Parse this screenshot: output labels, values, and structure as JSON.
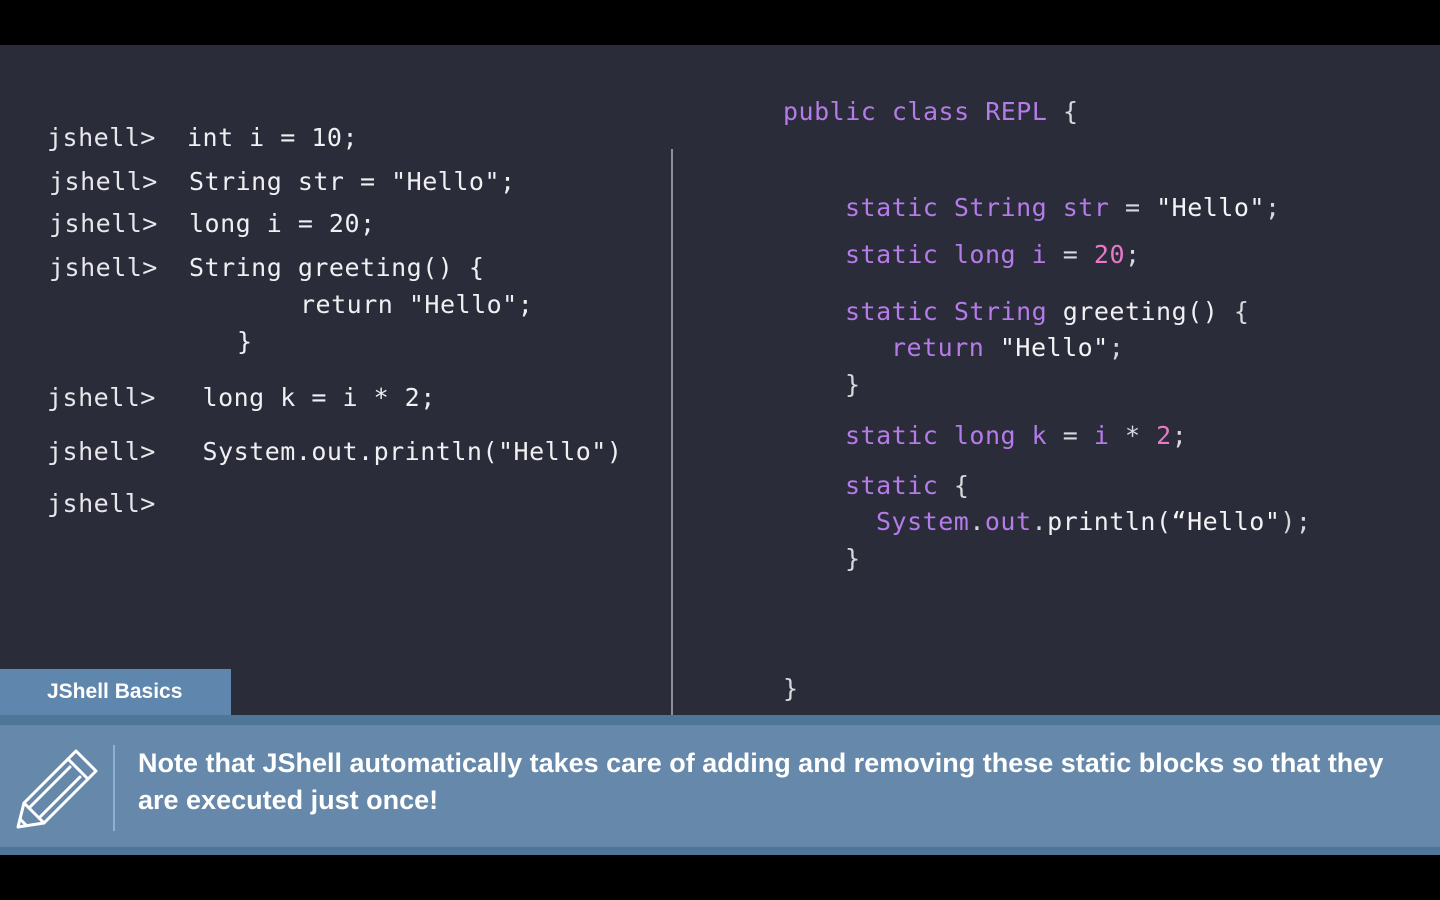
{
  "left_panel": {
    "prompt": "jshell>",
    "lines": [
      "int i = 10;",
      "String str = \"Hello\";",
      "long i = 20;",
      "String greeting() {",
      "return \"Hello\";",
      "}",
      "long k = i * 2;",
      "System.out.println(\"Hello\")"
    ]
  },
  "right_panel": {
    "class_open": [
      "public",
      "class",
      "REPL",
      "{"
    ],
    "str_decl": [
      "static",
      "String",
      "str",
      "=",
      "\"Hello\"",
      ";"
    ],
    "long_decl": [
      "static",
      "long",
      "i",
      "=",
      "20",
      ";"
    ],
    "greeting_decl": [
      "static",
      "String",
      "greeting()",
      "{"
    ],
    "greeting_return": [
      "return",
      "\"Hello\"",
      ";"
    ],
    "greeting_close": "}",
    "k_decl": [
      "static",
      "long",
      "k",
      "=",
      "i",
      "*",
      "2",
      ";"
    ],
    "static_block": [
      "static",
      "{"
    ],
    "println": [
      "System",
      ".",
      "out",
      ".",
      "println(",
      "“Hello\"",
      ");"
    ],
    "static_close": "}",
    "class_close": "}"
  },
  "tab_label": "JShell Basics",
  "note": {
    "icon": "pencil-icon",
    "text": "Note that JShell automatically takes care of adding and removing these static blocks so that they are executed just once!"
  },
  "colors": {
    "background": "#2a2c3a",
    "keyword": "#b57be8",
    "number": "#e879c8",
    "note_bar": "#6688aa"
  }
}
